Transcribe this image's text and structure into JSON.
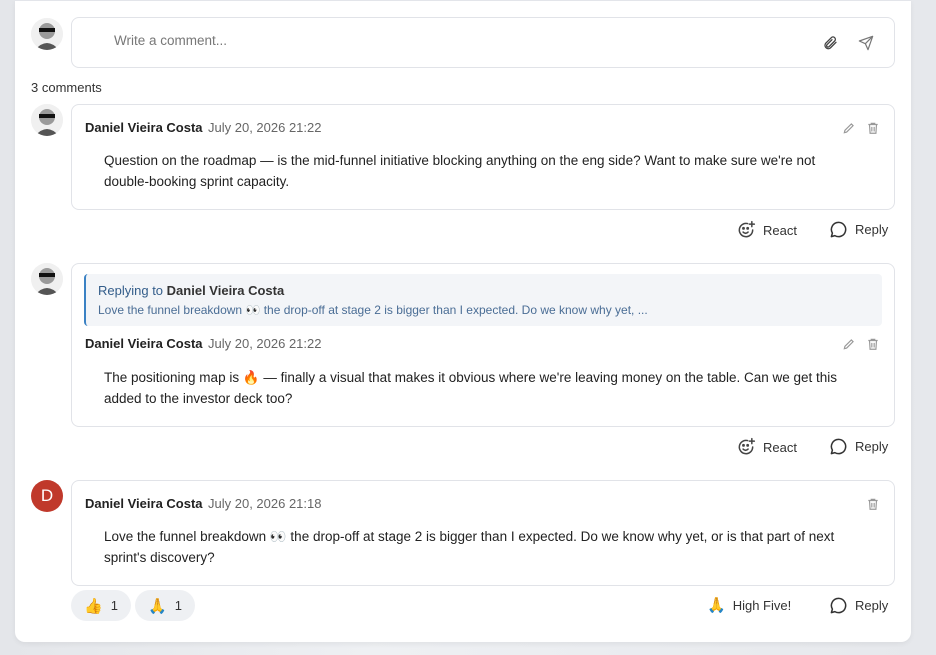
{
  "composer": {
    "placeholder": "Write a comment..."
  },
  "comment_count": "3 comments",
  "comments": [
    {
      "author": "Daniel Vieira Costa",
      "time": "July 20, 2026 21:22",
      "text": "Question on the roadmap — is the mid-funnel initiative blocking anything on the eng side? Want to make sure we're not double-booking sprint capacity.",
      "react_label": "React",
      "reply_label": "Reply"
    },
    {
      "reply_prefix": "Replying to",
      "reply_to": "Daniel Vieira Costa",
      "reply_excerpt": "Love the funnel breakdown 👀 the drop-off at stage 2 is bigger than I expected. Do we know why yet, ...",
      "author": "Daniel Vieira Costa",
      "time": "July 20, 2026 21:22",
      "text": "The positioning map is 🔥 — finally a visual that makes it obvious where we're leaving money on the table. Can we get this added to the investor deck too?",
      "react_label": "React",
      "reply_label": "Reply"
    },
    {
      "avatar_letter": "D",
      "author": "Daniel Vieira Costa",
      "time": "July 20, 2026 21:18",
      "text": "Love the funnel breakdown 👀 the drop-off at stage 2 is bigger than I expected. Do we know why yet, or is that part of next sprint's discovery?",
      "reactions": [
        {
          "emoji": "👍",
          "count": "1"
        },
        {
          "emoji": "🙏",
          "count": "1"
        }
      ],
      "high_five_emoji": "🙏",
      "high_five_label": "High Five!",
      "reply_label": "Reply"
    }
  ],
  "colors": {
    "accent": "#3b82c4",
    "avatar_d": "#c0392b",
    "border": "#e1e3e8"
  }
}
